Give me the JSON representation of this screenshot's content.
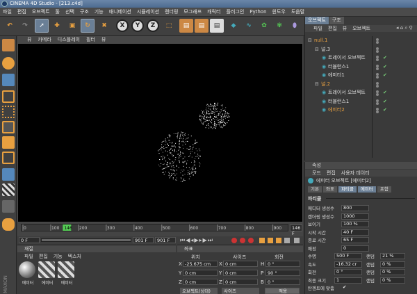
{
  "window": {
    "title": "CINEMA 4D Studio - [213.c4d]"
  },
  "menu": [
    "파일",
    "편집",
    "오브젝트",
    "툴",
    "선택",
    "구조",
    "기능",
    "애니메이션",
    "시뮬레이션",
    "렌더링",
    "모그래프",
    "캐릭터",
    "플러그인",
    "Python",
    "윈도우",
    "도움말"
  ],
  "viewport": {
    "menu": [
      "뷰",
      "카메라",
      "디스플레이",
      "필터",
      "뷰"
    ]
  },
  "timeline": {
    "ticks": [
      "0",
      "100",
      "146",
      "200",
      "300",
      "400",
      "500",
      "600",
      "700",
      "800",
      "900"
    ],
    "current_field": "146 F",
    "start_field": "0 F",
    "end_field": "901 F",
    "range_end": "901 F"
  },
  "materials": {
    "header": "재질",
    "menu": [
      "파일",
      "편집",
      "기능",
      "텍스처"
    ],
    "items": [
      "에미터",
      "에미터",
      "에미터"
    ],
    "logo": "MAXON"
  },
  "coords": {
    "header": "좌표",
    "col_pos": "위치",
    "col_size": "사이즈",
    "col_rot": "회전",
    "rows": [
      {
        "axis": "X",
        "pos": "-25.675 cm",
        "size_axis": "X",
        "size": "0 cm",
        "rot_axis": "H",
        "rot": "0 °"
      },
      {
        "axis": "Y",
        "pos": "0 cm",
        "size_axis": "Y",
        "size": "0 cm",
        "rot_axis": "P",
        "rot": "90 °"
      },
      {
        "axis": "Z",
        "pos": "0 cm",
        "size_axis": "Z",
        "size": "0 cm",
        "rot_axis": "B",
        "rot": "0 °"
      }
    ],
    "mode_btn": "오브젝트(상대)",
    "size_btn": "사이즈",
    "apply_btn": "적용"
  },
  "objects": {
    "tabs": [
      "오브젝트",
      "구조"
    ],
    "menu": [
      "파일",
      "편집",
      "뷰",
      "오브젝트"
    ],
    "rows": [
      {
        "name": "null.1",
        "indent": 0,
        "highlight": true
      },
      {
        "name": "널.3",
        "indent": 1,
        "highlight": false
      },
      {
        "name": "트레이서 오브젝트",
        "indent": 2,
        "highlight": false
      },
      {
        "name": "터뷸런스1",
        "indent": 2,
        "highlight": false
      },
      {
        "name": "에미터1",
        "indent": 2,
        "highlight": false
      },
      {
        "name": "널.2",
        "indent": 1,
        "highlight": true
      },
      {
        "name": "트레이서 오브젝트",
        "indent": 2,
        "highlight": false
      },
      {
        "name": "터뷸런스1",
        "indent": 2,
        "highlight": false
      },
      {
        "name": "에미터2",
        "indent": 2,
        "highlight": true
      }
    ]
  },
  "attributes": {
    "header": "속성",
    "menu": [
      "모드",
      "편집",
      "사용자 데이터"
    ],
    "object_title": "에미터 오브젝트 [에미터2]",
    "tabs": [
      "기본",
      "좌표",
      "파티클",
      "에미터",
      "포함"
    ],
    "section": "파티클",
    "rows": [
      {
        "label": "에디터 생성수",
        "value": "800"
      },
      {
        "label": "렌더링 생성수",
        "value": "1000"
      },
      {
        "label": "보이기",
        "value": "100 %"
      },
      {
        "label": "시작 시간",
        "value": "40 F"
      },
      {
        "label": "종료 시간",
        "value": "65 F"
      },
      {
        "label": "배정",
        "value": "0"
      },
      {
        "label": "수명",
        "value": "500 F",
        "var_label": "랜덤",
        "var": "21 %"
      },
      {
        "label": "속도",
        "value": "-16.32 cr",
        "var_label": "랜덤",
        "var": "0 %"
      },
      {
        "label": "회전",
        "value": "0 °",
        "var_label": "랜덤",
        "var": "0 %"
      },
      {
        "label": "최종 크기",
        "value": "1",
        "var_label": "랜덤",
        "var": "0 %"
      },
      {
        "label": "탄젠트에 맞춤",
        "value": "✔"
      }
    ]
  },
  "colors": {
    "accent": "#6b7f95",
    "highlight_text": "#e8a040",
    "check": "#77cc77"
  }
}
